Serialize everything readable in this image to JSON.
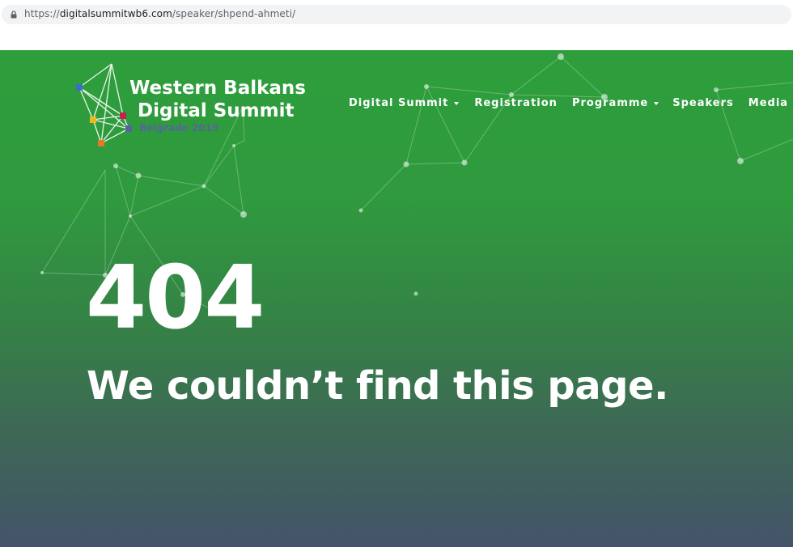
{
  "browser": {
    "url_scheme": "https://",
    "url_host": "digitalsummitwb6.com",
    "url_path": "/speaker/shpend-ahmeti/"
  },
  "logo": {
    "line1": "Western Balkans",
    "line2": "Digital Summit",
    "subtitle": "Belgrade 2019"
  },
  "nav": {
    "items": [
      {
        "label": "Digital Summit",
        "has_dropdown": true
      },
      {
        "label": "Registration",
        "has_dropdown": false
      },
      {
        "label": "Programme",
        "has_dropdown": true
      },
      {
        "label": "Speakers",
        "has_dropdown": false
      },
      {
        "label": "Media",
        "has_dropdown": true
      }
    ]
  },
  "error": {
    "code": "404",
    "message": "We couldn’t find this page."
  },
  "colors": {
    "gradient_top": "#2e9e3c",
    "gradient_bottom": "#44546a",
    "text": "#ffffff"
  }
}
